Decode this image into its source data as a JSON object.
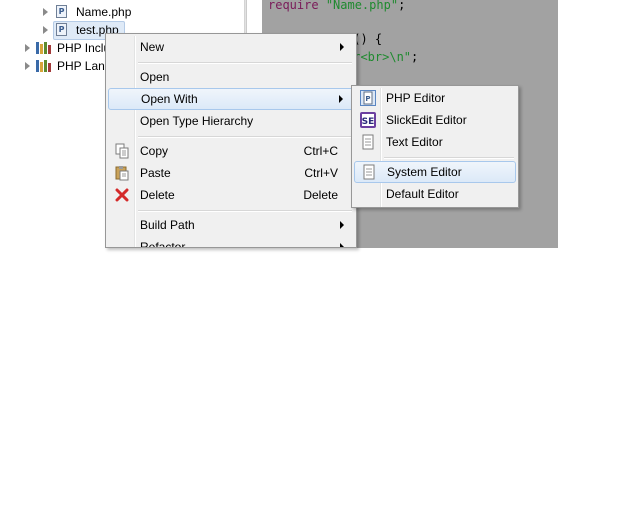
{
  "tree": {
    "items": [
      {
        "label": "Name.php",
        "icon": "php-file-icon"
      },
      {
        "label": "test.php",
        "icon": "php-file-icon",
        "selected": true
      },
      {
        "label": "PHP Inclu",
        "icon": "library-icon"
      },
      {
        "label": "PHP Lang",
        "icon": "library-icon"
      }
    ]
  },
  "editor": {
    "line1": {
      "keyword": "require",
      "string": "\"Name.php\"",
      "end": ";"
    },
    "line2": {
      "text": "r() {"
    },
    "line3": {
      "string": "ar<br>\\n\"",
      "end": ";"
    }
  },
  "context_menu": {
    "items": [
      {
        "label": "New",
        "submenu": true
      },
      {
        "label": "Open"
      },
      {
        "label": "Open With",
        "submenu": true,
        "highlighted": true
      },
      {
        "label": "Open Type Hierarchy"
      },
      {
        "label": "Copy",
        "shortcut": "Ctrl+C",
        "icon": "copy-icon"
      },
      {
        "label": "Paste",
        "shortcut": "Ctrl+V",
        "icon": "paste-icon"
      },
      {
        "label": "Delete",
        "shortcut": "Delete",
        "icon": "delete-icon"
      },
      {
        "label": "Build Path",
        "submenu": true
      },
      {
        "label": "Refactor",
        "submenu": true
      }
    ]
  },
  "open_with_menu": {
    "items": [
      {
        "label": "PHP Editor",
        "icon": "php-editor-icon"
      },
      {
        "label": "SlickEdit Editor",
        "icon": "slickedit-icon"
      },
      {
        "label": "Text Editor",
        "icon": "text-file-icon"
      },
      {
        "label": "System Editor",
        "icon": "system-editor-icon",
        "highlighted": true
      },
      {
        "label": "Default Editor"
      }
    ]
  },
  "colors": {
    "highlight_border": "#a8c8ec",
    "editor_bg": "#a2a2a2",
    "keyword": "#7a1b59",
    "string": "#1f8a2f",
    "delete_red": "#d42a2a"
  }
}
